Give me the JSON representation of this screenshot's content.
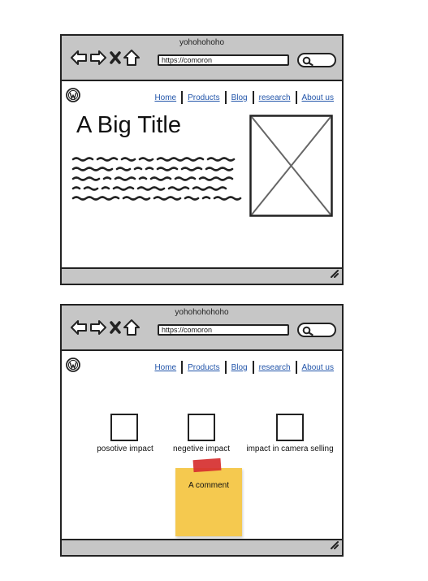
{
  "window1": {
    "title": "yohohohoho",
    "url": "https://comoron",
    "nav": [
      "Home",
      "Products",
      "Blog",
      "research",
      "About us"
    ],
    "big_title": "A Big Title"
  },
  "window2": {
    "title": "yohohohohoho",
    "url": "https://comoron",
    "nav": [
      "Home",
      "Products",
      "Blog",
      "research",
      "About us"
    ],
    "widgets": [
      "posotive impact",
      "negetive impact",
      "impact in camera selling"
    ],
    "comment": "A comment"
  },
  "icons": [
    "back-arrow-icon",
    "forward-arrow-icon",
    "close-x-icon",
    "home-icon",
    "search-icon",
    "wordpress-logo-icon",
    "resize-grip-icon"
  ],
  "colors": {
    "chrome": "#c6c6c6",
    "link": "#2255aa",
    "sticky": "#f5c94f",
    "tape": "#d62f2f"
  }
}
